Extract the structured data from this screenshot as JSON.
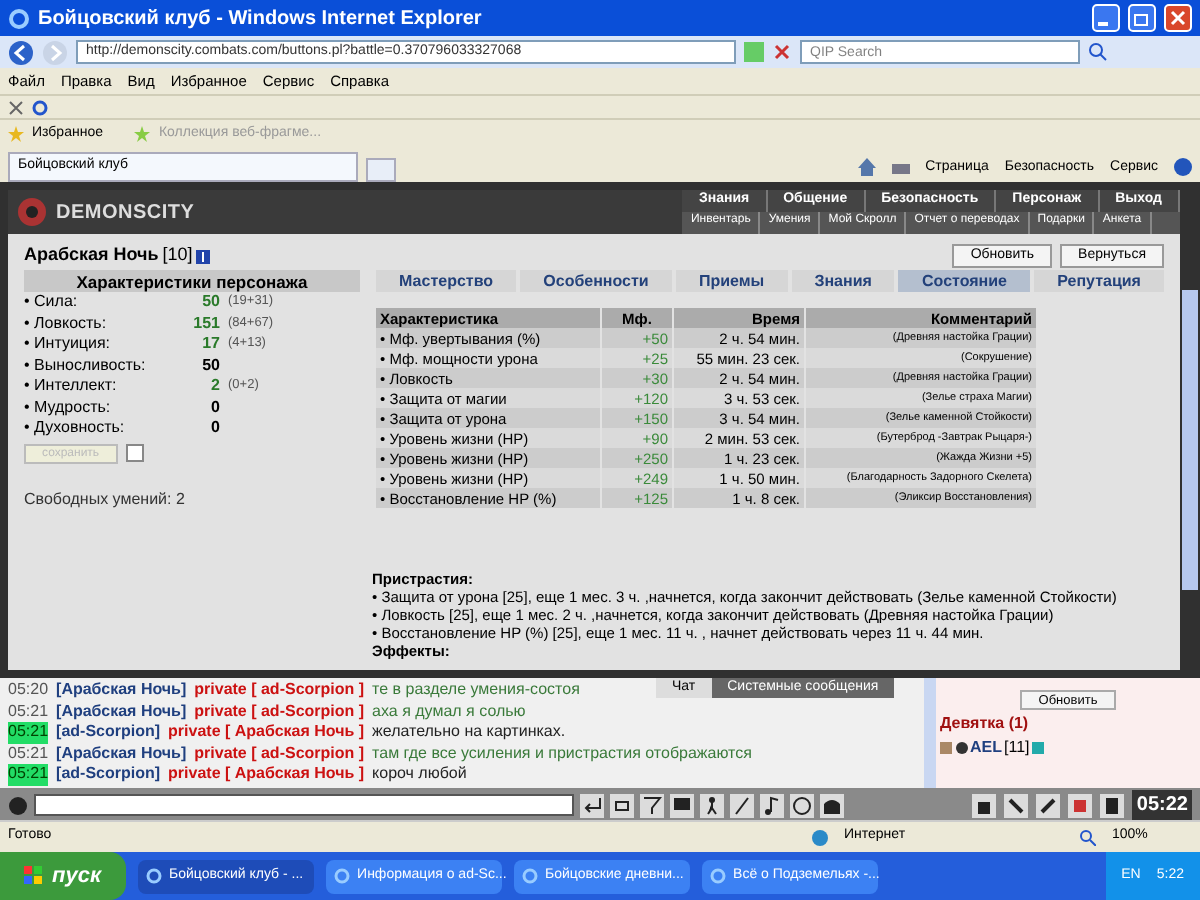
{
  "window": {
    "title": "Бойцовский клуб - Windows Internet Explorer"
  },
  "address_bar": {
    "value": "http://demonscity.combats.com/buttons.pl?battle=0.370796033327068"
  },
  "search": {
    "placeholder": "QIP Search"
  },
  "menu": [
    "Файл",
    "Правка",
    "Вид",
    "Избранное",
    "Сервис",
    "Справка"
  ],
  "favorites_bar": {
    "favorites": "Избранное",
    "item": "Коллекция веб-фрагме..."
  },
  "browser_tab": {
    "label": "Бойцовский клуб"
  },
  "command_bar": [
    "Страница",
    "Безопасность",
    "Сервис"
  ],
  "game": {
    "logo": "DEMONSCITY",
    "nav_top": [
      "Знания",
      "Общение",
      "Безопасность",
      "Персонаж",
      "Выход"
    ],
    "nav_sub": [
      "Инвентарь",
      "Умения",
      "Мой Скролл",
      "Отчет о переводах",
      "Подарки",
      "Анкета"
    ],
    "character": {
      "name": "Арабская Ночь",
      "level": "[10]"
    },
    "buttons": [
      "Обновить",
      "Вернуться"
    ],
    "stats_title": "Характеристики персонажа",
    "stats": [
      {
        "name": "• Сила:",
        "value": "50",
        "extra": "(19+31)",
        "boosted": true
      },
      {
        "name": "• Ловкость:",
        "value": "151",
        "extra": "(84+67)",
        "boosted": true
      },
      {
        "name": "• Интуиция:",
        "value": "17",
        "extra": "(4+13)",
        "boosted": true
      },
      {
        "name": "• Выносливость:",
        "value": "50",
        "boosted": false
      },
      {
        "name": "• Интеллект:",
        "value": "2",
        "extra": "(0+2)",
        "boosted": true
      },
      {
        "name": "• Мудрость:",
        "value": "0",
        "boosted": false
      },
      {
        "name": "• Духовность:",
        "value": "0",
        "boosted": false
      }
    ],
    "save_button": {
      "label": "сохранить",
      "disabled": true
    },
    "save_checkbox": {
      "checked": false
    },
    "free_skills": "Свободных умений: 2",
    "tabs": [
      {
        "label": "Мастерство",
        "selected": false
      },
      {
        "label": "Особенности",
        "selected": false
      },
      {
        "label": "Приемы",
        "selected": false
      },
      {
        "label": "Знания",
        "selected": false
      },
      {
        "label": "Состояние",
        "selected": true
      },
      {
        "label": "Репутация",
        "selected": false
      }
    ],
    "table": {
      "columns": [
        "Характеристика",
        "Мф.",
        "Время",
        "Комментарий"
      ],
      "rows": [
        [
          "• Мф. увертывания (%)",
          "+50",
          "2 ч. 54 мин.",
          "(Древняя настойка Грации)"
        ],
        [
          "• Мф. мощности урона",
          "+25",
          "55 мин. 23 сек.",
          "(Сокрушение)"
        ],
        [
          "• Ловкость",
          "+30",
          "2 ч. 54 мин.",
          "(Древняя настойка Грации)"
        ],
        [
          "• Защита от магии",
          "+120",
          "3 ч. 53 сек.",
          "(Зелье страха Магии)"
        ],
        [
          "• Защита от урона",
          "+150",
          "3 ч. 54 мин.",
          "(Зелье каменной Стойкости)"
        ],
        [
          "• Уровень жизни (HP)",
          "+90",
          "2 мин. 53 сек.",
          "(Бутерброд -Завтрак Рыцаря-)"
        ],
        [
          "• Уровень жизни (HP)",
          "+250",
          "1 ч. 23 сек.",
          "(Жажда Жизни +5)"
        ],
        [
          "• Уровень жизни (HP)",
          "+249",
          "1 ч. 50 мин.",
          "(Благодарность Задорного Скелета)"
        ],
        [
          "• Восстановление HP (%)",
          "+125",
          "1 ч. 8 сек.",
          "(Эликсир Восстановления)"
        ]
      ]
    },
    "addictions": {
      "title": "Пристрастия:",
      "items": [
        "• Защита от урона [25], еще 1 мес. 3 ч. ,начнется, когда закончит действовать (Зелье каменной Стойкости)",
        "• Ловкость [25], еще 1 мес. 2 ч. ,начнется, когда закончит действовать (Древняя настойка Грации)",
        "• Восстановление HP (%) [25], еще 1 мес. 11 ч. , начнет действовать через 11 ч. 44 мин."
      ]
    },
    "effects_title": "Эффекты:"
  },
  "chat": {
    "tabs": [
      {
        "label": "Чат",
        "selected": true
      },
      {
        "label": "Системные сообщения",
        "selected": false
      }
    ],
    "messages": [
      {
        "time": "05:20",
        "sender": "[Арабская Ночь]",
        "private": "private [ ad-Scorpion ]",
        "text": "те в разделе умения-состоя",
        "highlighted": false
      },
      {
        "time": "05:21",
        "sender": "[Арабская Ночь]",
        "private": "private [ ad-Scorpion ]",
        "text": "аха я думал я солью",
        "highlighted": false
      },
      {
        "time": "05:21",
        "sender": "[ad-Scorpion]",
        "private": "private [ Арабская Ночь ]",
        "text": "желательно на картинках.",
        "highlighted": true
      },
      {
        "time": "05:21",
        "sender": "[Арабская Ночь]",
        "private": "private [ ad-Scorpion ]",
        "text": "там где все усиления и пристрастия отображаются",
        "highlighted": false
      },
      {
        "time": "05:21",
        "sender": "[ad-Scorpion]",
        "private": "private [ Арабская Ночь ]",
        "text": "короч любой",
        "highlighted": true
      }
    ],
    "refresh": "Обновить",
    "room": "Девятка (1)",
    "users": [
      {
        "name": "AEL",
        "level": "[11]"
      }
    ],
    "clock": "05:22"
  },
  "status_bar": {
    "text": "Готово",
    "zone": "Интернет",
    "zoom": "100%"
  },
  "taskbar": {
    "start": "пуск",
    "items": [
      {
        "label": "Бойцовский клуб - ...",
        "selected": true
      },
      {
        "label": "Информация о ad-Sc...",
        "selected": false
      },
      {
        "label": "Бойцовские дневни...",
        "selected": false
      },
      {
        "label": "Всё о Подземельях -...",
        "selected": false
      }
    ],
    "lang": "EN",
    "clock": "5:22"
  }
}
